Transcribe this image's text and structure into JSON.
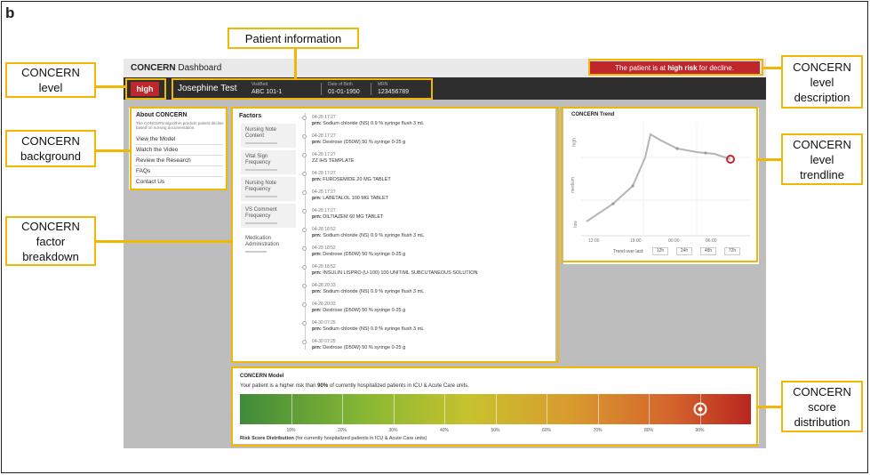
{
  "panel_letter": "b",
  "callouts": {
    "patient_information": "Patient information",
    "concern_level": "CONCERN level",
    "concern_background": "CONCERN background",
    "concern_factor_breakdown": "CONCERN factor breakdown",
    "concern_level_description": "CONCERN level description",
    "concern_level_trendline": "CONCERN level trendline",
    "concern_score_distribution": "CONCERN score distribution"
  },
  "header": {
    "app_title_bold": "CONCERN",
    "app_title_rest": "Dashboard",
    "alert_prefix": "The patient is at",
    "alert_emphasis": "high risk",
    "alert_suffix": "for decline."
  },
  "patient": {
    "level": "high",
    "name": "Josephine Test",
    "visit_label": "VisitBed",
    "visit_value": "ABC 101-1",
    "dob_label": "Date of Birth",
    "dob_value": "01-01-1950",
    "mrn_label": "MRN",
    "mrn_value": "123456789"
  },
  "about": {
    "title": "About CONCERN",
    "description": "The CONCERN algorithm predicts patient decline based on nursing documentation.",
    "links": [
      "View the Model",
      "Watch the Video",
      "Review the Research",
      "FAQs",
      "Contact Us"
    ]
  },
  "factors": {
    "title": "Factors",
    "items": [
      "Nursing Note Content",
      "Vital Sign Frequency",
      "Nursing Note Frequency",
      "VS Comment Frequency",
      "Medication Administration"
    ],
    "events": [
      {
        "time": "04-28 17:27",
        "prn": "prn:",
        "desc": "Sodium chloride (NS) 0.9 % syringe flush 3 mL"
      },
      {
        "time": "04-28 17:27",
        "prn": "prn:",
        "desc": "Dextrose (D50W) 50 % syringe 0-25 g"
      },
      {
        "time": "04-28 17:27",
        "prn": "",
        "desc": "ZZ IHS TEMPLATE"
      },
      {
        "time": "04-28 17:27",
        "prn": "prn:",
        "desc": "FUROSEMIDE 20 MG TABLET"
      },
      {
        "time": "04-28 17:27",
        "prn": "prn:",
        "desc": "LABETALOL 100 MG TABLET"
      },
      {
        "time": "04-28 17:27",
        "prn": "prn:",
        "desc": "DILTIAZEM 60 MG TABLET"
      },
      {
        "time": "04-28 18:52",
        "prn": "prn:",
        "desc": "Sodium chloride (NS) 0.9 % syringe flush 3 mL"
      },
      {
        "time": "04-28 18:52",
        "prn": "prn:",
        "desc": "Dextrose (D50W) 50 % syringe 0-25 g"
      },
      {
        "time": "04-28 18:52",
        "prn": "prn:",
        "desc": "INSULIN LISPRO (U-100) 100 UNIT/ML SUBCUTANEOUS SOLUTION"
      },
      {
        "time": "04-28 20:33",
        "prn": "prn:",
        "desc": "Sodium chloride (NS) 0.9 % syringe flush 3 mL"
      },
      {
        "time": "04-28 20:33",
        "prn": "prn:",
        "desc": "Dextrose (D50W) 50 % syringe 0-25 g"
      },
      {
        "time": "04-30 07:25",
        "prn": "prn:",
        "desc": "Sodium chloride (NS) 0.9 % syringe flush 3 mL"
      },
      {
        "time": "04-30 07:25",
        "prn": "prn:",
        "desc": "Dextrose (D50W) 50 % syringe 0-25 g"
      }
    ]
  },
  "trend": {
    "title": "CONCERN Trend",
    "y_levels": [
      "high",
      "medium",
      "low"
    ],
    "x_ticks": [
      "12:00",
      "18:00",
      "00:00",
      "06:00"
    ],
    "trend_over_last": "Trend over last:",
    "buttons": [
      "12h",
      "24h",
      "48h",
      "72h"
    ]
  },
  "model": {
    "title": "CONCERN Model",
    "text_prefix": "Your patient is a higher risk than",
    "text_percent": "90%",
    "text_suffix": "of currently hospitalized patients in ICU & Acute Care units.",
    "scale_labels": [
      "10%",
      "20%",
      "30%",
      "40%",
      "50%",
      "60%",
      "70%",
      "80%",
      "90%"
    ],
    "patient_percentile": 90,
    "footer_bold": "Risk Score Distribution",
    "footer_rest": "(for currently hospitalized patients in ICU & Acute Care units)"
  },
  "colors": {
    "callout_border": "#f2b705",
    "high_risk_red": "#c0272d",
    "patient_bar": "#2e2e2e"
  }
}
